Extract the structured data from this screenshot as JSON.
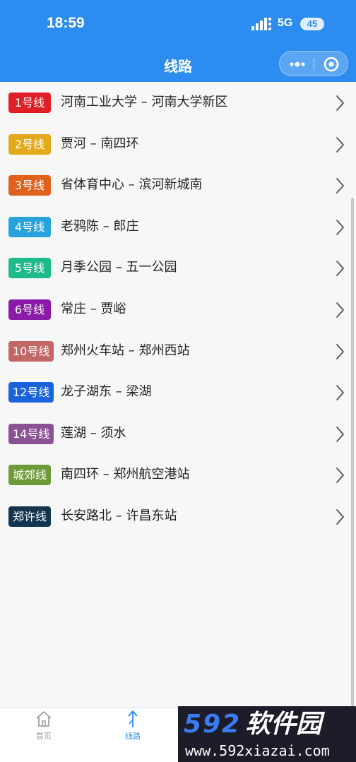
{
  "status_bar": {
    "time": "18:59",
    "network": "5G",
    "battery": "45"
  },
  "nav": {
    "title": "线路"
  },
  "colors": {
    "header": "#2d8cf0",
    "tab_active": "#2d8cf0",
    "tab_inactive": "#9aa0a6"
  },
  "lines": [
    {
      "badge": "1号线",
      "route": "河南工业大学 – 河南大学新区",
      "color": "#e11f26"
    },
    {
      "badge": "2号线",
      "route": "贾河 – 南四环",
      "color": "#e2a91a"
    },
    {
      "badge": "3号线",
      "route": "省体育中心 – 滨河新城南",
      "color": "#e0601e"
    },
    {
      "badge": "4号线",
      "route": "老鸦陈 – 郎庄",
      "color": "#27a2dc"
    },
    {
      "badge": "5号线",
      "route": "月季公园 – 五一公园",
      "color": "#1dba8c"
    },
    {
      "badge": "6号线",
      "route": "常庄 – 贾峪",
      "color": "#8a1aa8"
    },
    {
      "badge": "10号线",
      "route": "郑州火车站 – 郑州西站",
      "color": "#c26767"
    },
    {
      "badge": "12号线",
      "route": "龙子湖东 – 梁湖",
      "color": "#1b63dd"
    },
    {
      "badge": "14号线",
      "route": "莲湖 – 须水",
      "color": "#8b5195"
    },
    {
      "badge": "城郊线",
      "route": "南四环 – 郑州航空港站",
      "color": "#6e9b3a"
    },
    {
      "badge": "郑许线",
      "route": "长安路北 – 许昌东站",
      "color": "#13354f"
    }
  ],
  "tabbar": {
    "tabs": [
      {
        "label": "首页",
        "icon": "home-icon",
        "active": false
      },
      {
        "label": "线路",
        "icon": "route-icon",
        "active": true
      }
    ]
  },
  "watermark": {
    "digits": "592",
    "text": "软件园",
    "url": "www.592xiazai.com"
  }
}
